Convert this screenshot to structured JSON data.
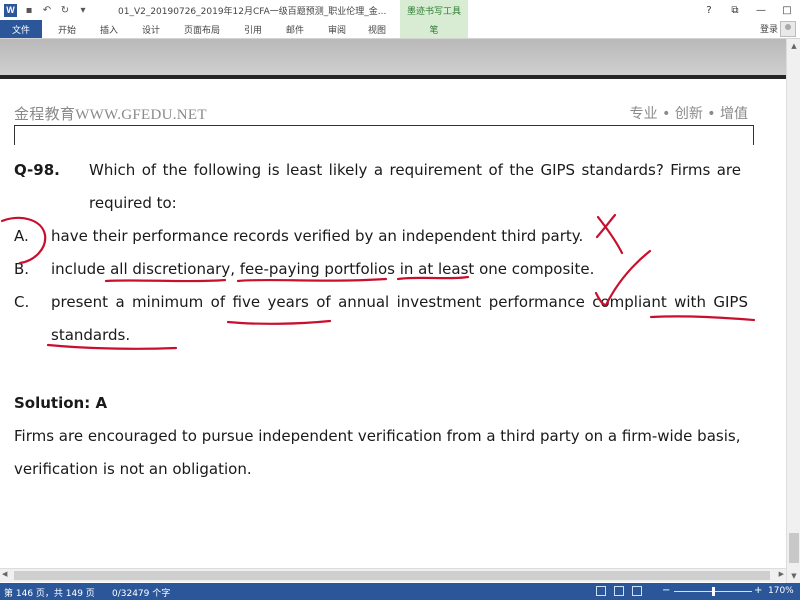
{
  "titlebar": {
    "app_icon": "word-icon",
    "quick_access": [
      "save-icon",
      "undo-icon",
      "redo-icon",
      "customize-icon"
    ],
    "document_title": "01_V2_20190726_2019年12月CFA一级百题预测_职业伦理_金...",
    "context_tab_title": "墨迹书写工具",
    "window_buttons": [
      "?",
      "⧉",
      "—",
      "□"
    ]
  },
  "ribbon": {
    "file_tab": "文件",
    "tabs": [
      "开始",
      "插入",
      "设计",
      "页面布局",
      "引用",
      "邮件",
      "审阅",
      "视图"
    ],
    "context_tab": "笔",
    "login": "登录"
  },
  "document": {
    "header_left": "金程教育WWW.GFEDU.NET",
    "header_right": "专业 • 创新 • 增值",
    "question": {
      "number": "Q-98.",
      "stem_line1": "Which of the following is least likely a requirement of the GIPS standards? Firms are",
      "stem_line2": "required to:",
      "options": [
        {
          "letter": "A.",
          "text": "have their performance records verified by an independent third party."
        },
        {
          "letter": "B.",
          "text": "include all discretionary, fee-paying portfolios in at least one composite."
        },
        {
          "letter": "C.",
          "text_line1": "present a minimum of five years of annual investment performance compliant with GIPS",
          "text_line2": "standards."
        }
      ]
    },
    "solution_label": "Solution: A",
    "solution_line1": "Firms are encouraged to pursue independent verification from a third party on a firm-wide basis,",
    "solution_line2": "verification is not an obligation."
  },
  "statusbar": {
    "page_info": "第 146 页，共 149 页",
    "word_count": "0/32479 个字",
    "zoom_minus": "−",
    "zoom_plus": "+",
    "zoom_level": "170%"
  },
  "colors": {
    "ribbon_blue": "#2b579a",
    "ink_red": "#c8102e",
    "pen_tab_green": "#d8ecd4"
  }
}
